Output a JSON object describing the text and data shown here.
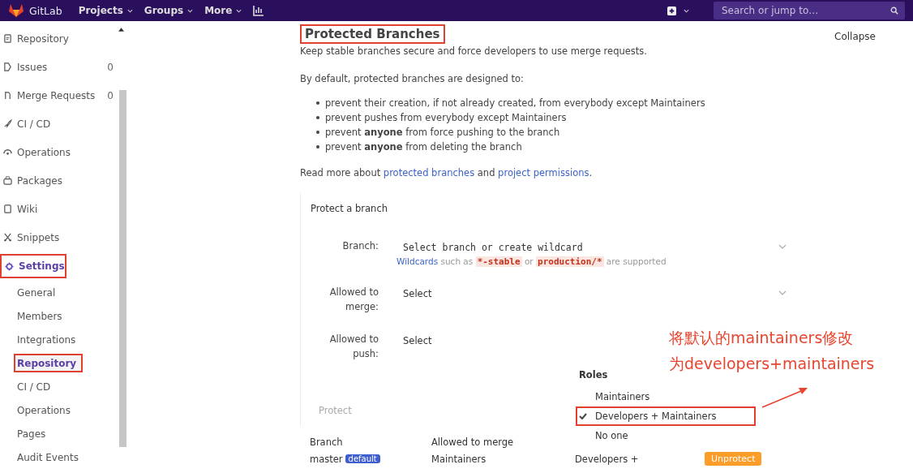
{
  "navbar": {
    "brand": "GitLab",
    "menus": [
      {
        "label": "Projects"
      },
      {
        "label": "Groups"
      },
      {
        "label": "More"
      }
    ],
    "search": {
      "placeholder": "Search or jump to…"
    }
  },
  "sidebar": {
    "items": [
      {
        "label": "Repository",
        "selected": false,
        "highlighted": false
      },
      {
        "label": "Issues",
        "count": "0",
        "selected": false,
        "highlighted": false
      },
      {
        "label": "Merge Requests",
        "count": "0",
        "selected": false,
        "highlighted": false
      },
      {
        "label": "CI / CD",
        "selected": false,
        "highlighted": false
      },
      {
        "label": "Operations",
        "selected": false,
        "highlighted": false
      },
      {
        "label": "Packages",
        "selected": false,
        "highlighted": false
      },
      {
        "label": "Wiki",
        "selected": false,
        "highlighted": false
      },
      {
        "label": "Snippets",
        "selected": false,
        "highlighted": false
      },
      {
        "label": "Settings",
        "selected": true,
        "highlighted": true,
        "children": [
          {
            "label": "General",
            "selected": false,
            "highlighted": false
          },
          {
            "label": "Members",
            "selected": false,
            "highlighted": false
          },
          {
            "label": "Integrations",
            "selected": false,
            "highlighted": false
          },
          {
            "label": "Repository",
            "selected": true,
            "highlighted": true
          },
          {
            "label": "CI / CD",
            "selected": false,
            "highlighted": false
          },
          {
            "label": "Operations",
            "selected": false,
            "highlighted": false
          },
          {
            "label": "Pages",
            "selected": false,
            "highlighted": false
          },
          {
            "label": "Audit Events",
            "selected": false,
            "highlighted": false
          }
        ]
      }
    ]
  },
  "section": {
    "title": "Protected Branches",
    "title_highlighted": true,
    "collapse": "Collapse",
    "intro": "Keep stable branches secure and force developers to use merge requests.",
    "default_intro": "By default, protected branches are designed to:",
    "bullets": [
      "prevent their creation, if not already created, from everybody except Maintainers",
      "prevent pushes from everybody except Maintainers",
      "prevent **anyone** from force pushing to the branch",
      "prevent **anyone** from deleting the branch"
    ],
    "read_more": [
      {
        "kind": "text",
        "text": "Read more about "
      },
      {
        "kind": "link",
        "text": "protected branches"
      },
      {
        "kind": "text",
        "text": " and "
      },
      {
        "kind": "link",
        "text": "project permissions"
      },
      {
        "kind": "text",
        "text": "."
      }
    ]
  },
  "protect_form": {
    "title": "Protect a branch",
    "fields": [
      {
        "label": "Branch:",
        "value": "Select branch or create wildcard",
        "kind": "mono",
        "help": [
          {
            "kind": "link",
            "text": "Wildcards"
          },
          {
            "kind": "text",
            "text": " such as "
          },
          {
            "kind": "code",
            "text": "*-stable"
          },
          {
            "kind": "text",
            "text": " or "
          },
          {
            "kind": "code",
            "text": "production/*"
          },
          {
            "kind": "text",
            "text": " are supported"
          }
        ]
      },
      {
        "label": "Allowed to merge:",
        "value": "Select",
        "kind": "plain"
      },
      {
        "label": "Allowed to push:",
        "value": "Select",
        "kind": "plain"
      }
    ],
    "button": {
      "label": "Protect",
      "disabled": true
    }
  },
  "roles_dropdown": {
    "header": "Roles",
    "options": [
      {
        "label": "Maintainers",
        "selected": false,
        "highlighted": false
      },
      {
        "label": "Developers + Maintainers",
        "selected": true,
        "highlighted": true
      },
      {
        "label": "No one",
        "selected": false,
        "highlighted": false
      }
    ]
  },
  "table": {
    "columns": [
      "Branch",
      "Allowed to merge"
    ],
    "rows": [
      {
        "branch": "master",
        "badge": "default",
        "merge": "Maintainers",
        "push": "Developers +",
        "action": "Unprotect"
      }
    ]
  },
  "annotation": {
    "lines": [
      "将默认的maintainers修改",
      "为developers+maintainers"
    ]
  }
}
